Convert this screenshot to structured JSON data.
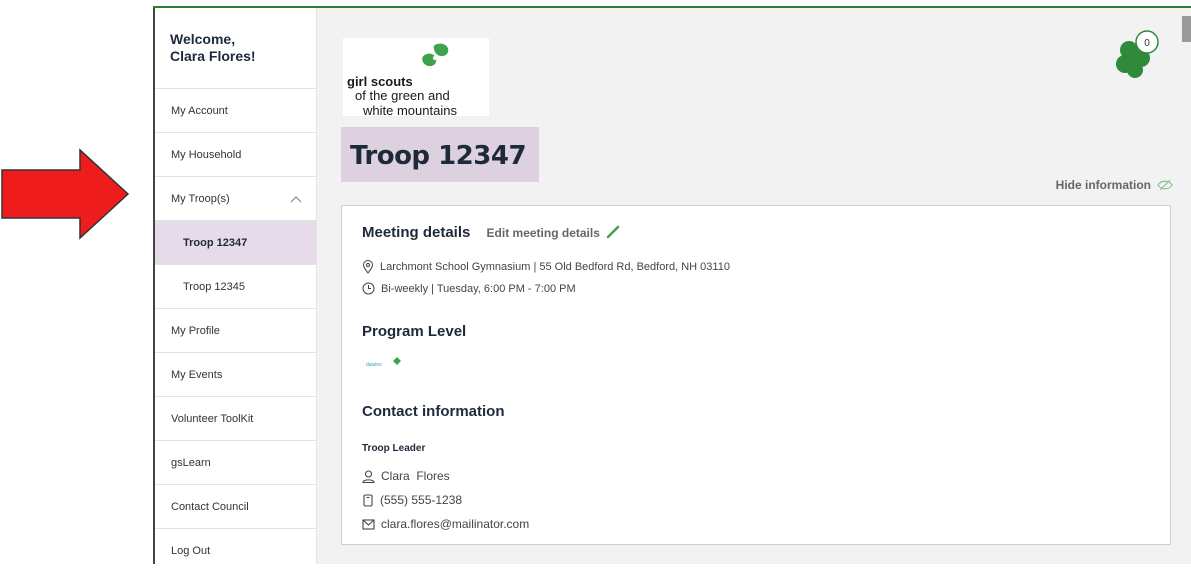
{
  "sidebar": {
    "welcome": "Welcome,",
    "user_name": "Clara Flores!",
    "items": [
      {
        "label": "My Account"
      },
      {
        "label": "My Household"
      },
      {
        "label": "My Troop(s)"
      },
      {
        "label": "Troop 12347"
      },
      {
        "label": "Troop 12345"
      },
      {
        "label": "My Profile"
      },
      {
        "label": "My Events"
      },
      {
        "label": "Volunteer ToolKit"
      },
      {
        "label": "gsLearn"
      },
      {
        "label": "Contact Council"
      },
      {
        "label": "Log Out"
      }
    ]
  },
  "logo": {
    "title": "girl scouts",
    "subtitle_line1": "of the green and",
    "subtitle_line2": "white mountains"
  },
  "header": {
    "troop_title": "Troop 12347",
    "notification_count": "0",
    "hide_info": "Hide information"
  },
  "meeting": {
    "title": "Meeting details",
    "edit_label": "Edit meeting details",
    "location": "Larchmont School Gymnasium | 55 Old Bedford Rd, Bedford, NH 03110",
    "schedule": "Bi-weekly | Tuesday, 6:00 PM - 7:00 PM"
  },
  "program": {
    "title": "Program Level",
    "level": "daisies"
  },
  "contact": {
    "title": "Contact information",
    "role": "Troop Leader",
    "name": "Clara  Flores",
    "phone": "(555) 555-1238",
    "email": "clara.flores@mailinator.com"
  },
  "colors": {
    "accent_green": "#2e7d32",
    "troop_highlight": "#ddd1e0",
    "active_nav": "#e5dbe9",
    "annotation_arrow": "#ee1c1c"
  },
  "icons": [
    "right-arrow-annotation",
    "chevron-up-icon",
    "pencil-icon",
    "eye-slash-icon",
    "clover-icon",
    "location-pin-icon",
    "clock-icon",
    "person-icon",
    "phone-icon",
    "mail-icon"
  ]
}
